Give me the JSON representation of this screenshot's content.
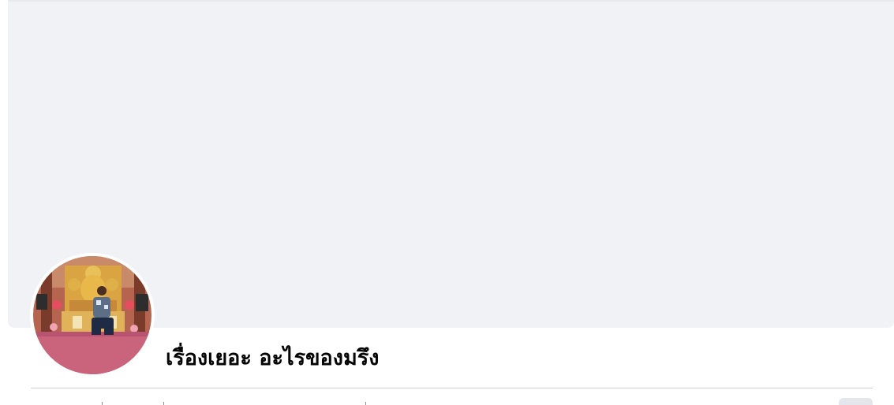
{
  "profile": {
    "name": "เรื่องเยอะ อะไรของมรึง",
    "avatar_icon": "profile-photo-temple"
  },
  "colors": {
    "cover": "#f0f2f5",
    "text": "#050505",
    "divider": "#ced0d4"
  }
}
